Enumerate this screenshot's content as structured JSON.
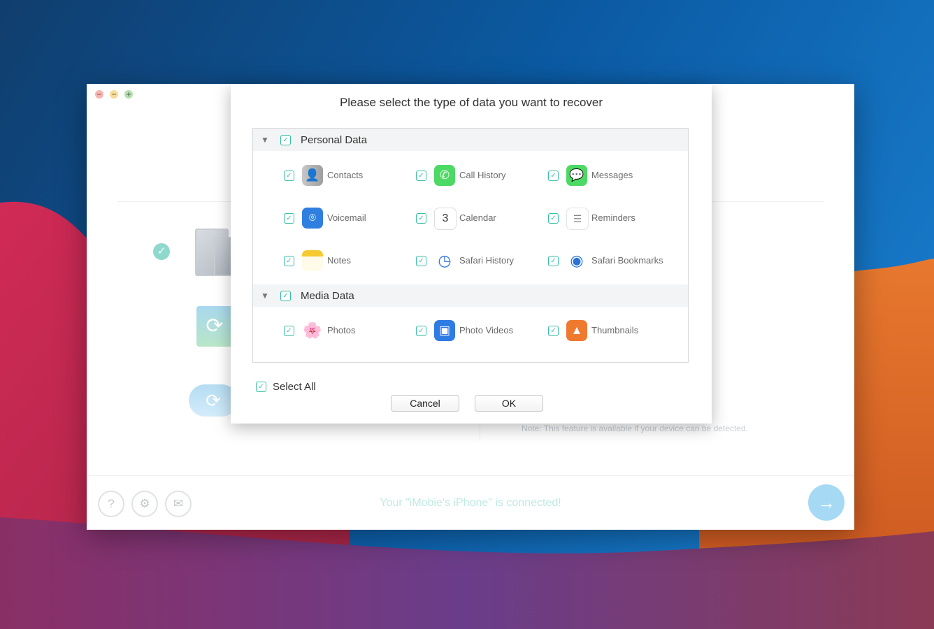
{
  "wallpaper": {
    "colors": {
      "top_left": "#103e6e",
      "top_right": "#1677c6",
      "left_wave": "#d02a56",
      "right_wave": "#e7782e",
      "bottom": "#6a3d8a"
    }
  },
  "window": {
    "note": "Note: This feature is available if your device can be detected.",
    "status": "Your \"iMobie's iPhone\" is connected!",
    "footer_icons": [
      "help-icon",
      "gear-icon",
      "mail-icon"
    ],
    "next_icon": "arrow-right-icon"
  },
  "dialog": {
    "title": "Please select the type of data you want to recover",
    "sections": [
      {
        "label": "Personal Data",
        "items": [
          {
            "label": "Contacts",
            "icon": "contacts-icon"
          },
          {
            "label": "Call History",
            "icon": "phone-icon"
          },
          {
            "label": "Messages",
            "icon": "messages-icon"
          },
          {
            "label": "Voicemail",
            "icon": "voicemail-icon"
          },
          {
            "label": "Calendar",
            "icon": "calendar-icon",
            "glyph": "3"
          },
          {
            "label": "Reminders",
            "icon": "reminders-icon"
          },
          {
            "label": "Notes",
            "icon": "notes-icon"
          },
          {
            "label": "Safari History",
            "icon": "safari-history-icon"
          },
          {
            "label": "Safari Bookmarks",
            "icon": "safari-bookmarks-icon"
          }
        ]
      },
      {
        "label": "Media Data",
        "items": [
          {
            "label": "Photos",
            "icon": "photos-icon"
          },
          {
            "label": "Photo Videos",
            "icon": "photo-videos-icon"
          },
          {
            "label": "Thumbnails",
            "icon": "thumbnails-icon"
          }
        ]
      }
    ],
    "select_all": "Select All",
    "cancel": "Cancel",
    "ok": "OK",
    "accent_color": "#35bfa8"
  }
}
